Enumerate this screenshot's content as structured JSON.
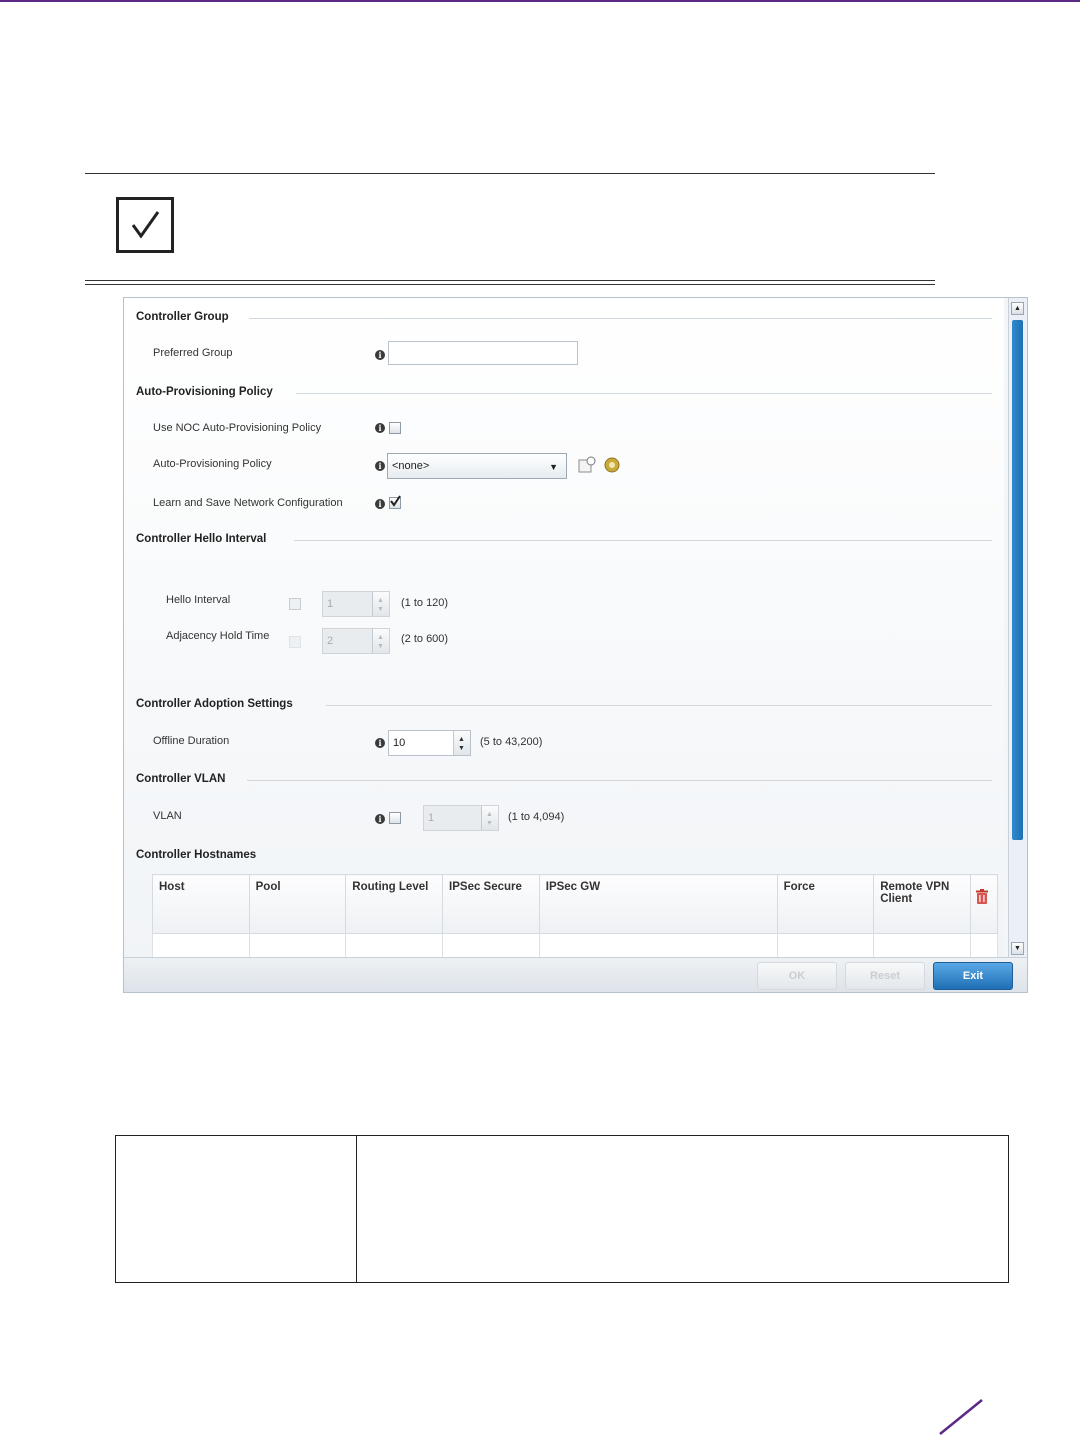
{
  "note": {
    "icon": "checkmark-icon"
  },
  "form": {
    "controller_group": {
      "heading": "Controller Group",
      "preferred_group_label": "Preferred Group",
      "preferred_group_value": ""
    },
    "auto_provisioning": {
      "heading": "Auto-Provisioning Policy",
      "use_noc_label": "Use NOC Auto-Provisioning Policy",
      "use_noc_checked": false,
      "policy_label": "Auto-Provisioning Policy",
      "policy_value": "<none>",
      "learn_save_label": "Learn and Save Network Configuration",
      "learn_save_checked": true
    },
    "hello_interval": {
      "heading": "Controller Hello Interval",
      "hello_label": "Hello Interval",
      "hello_value": "1",
      "hello_range": "(1 to 120)",
      "adjacency_label": "Adjacency Hold Time",
      "adjacency_value": "2",
      "adjacency_range": "(2 to 600)"
    },
    "adoption": {
      "heading": "Controller Adoption Settings",
      "offline_label": "Offline Duration",
      "offline_value": "10",
      "offline_range": "(5 to 43,200)"
    },
    "vlan": {
      "heading": "Controller VLAN",
      "vlan_label": "VLAN",
      "vlan_value": "1",
      "vlan_range": "(1 to 4,094)"
    },
    "hostnames": {
      "heading": "Controller Hostnames",
      "columns": [
        "Host",
        "Pool",
        "Routing Level",
        "IPSec Secure",
        "IPSec GW",
        "Force",
        "Remote VPN Client"
      ]
    },
    "buttons": {
      "ok": "OK",
      "reset": "Reset",
      "exit": "Exit"
    }
  },
  "colors": {
    "accent": "#5b2a86",
    "exit_button": "#1f6fb6",
    "scroll_thumb": "#2f8ad0"
  }
}
